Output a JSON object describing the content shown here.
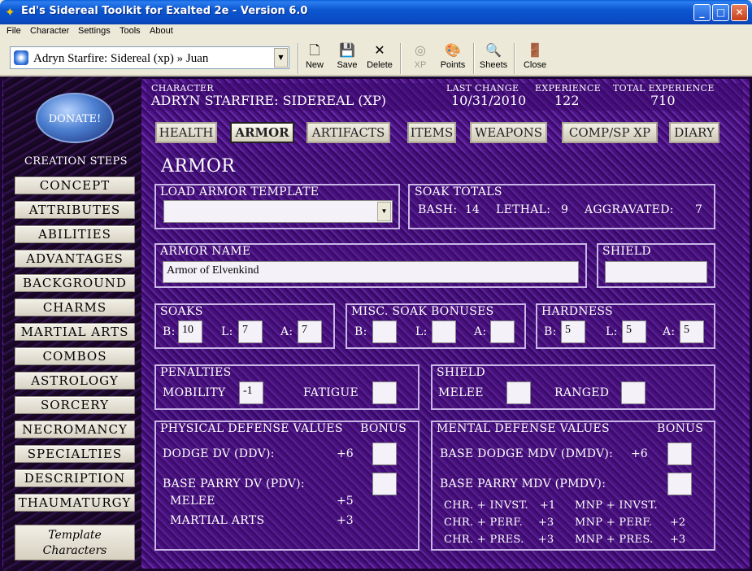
{
  "window": {
    "title": "Ed's Sidereal Toolkit for Exalted 2e - Version 6.0",
    "min_label": "_",
    "max_label": "□",
    "close_label": "✕"
  },
  "menu": [
    "File",
    "Character",
    "Settings",
    "Tools",
    "About"
  ],
  "toolbar": {
    "character_select": "Adryn Starfire: Sidereal (xp) » Juan",
    "buttons": [
      {
        "label": "New",
        "icon": "new-document-icon",
        "glyph": "🗋",
        "enabled": true
      },
      {
        "label": "Save",
        "icon": "save-disk-icon",
        "glyph": "💾",
        "enabled": true
      },
      {
        "label": "Delete",
        "icon": "delete-x-icon",
        "glyph": "✕",
        "enabled": true
      },
      {
        "label": "XP",
        "icon": "xp-icon",
        "glyph": "◎",
        "enabled": false
      },
      {
        "label": "Points",
        "icon": "points-palette-icon",
        "glyph": "🎨",
        "enabled": true
      },
      {
        "label": "Sheets",
        "icon": "sheets-search-icon",
        "glyph": "🔍",
        "enabled": true
      },
      {
        "label": "Close",
        "icon": "close-door-icon",
        "glyph": "🚪",
        "enabled": true
      }
    ]
  },
  "sidebar": {
    "donate_label": "DONATE!",
    "steps_title": "CREATION STEPS",
    "steps": [
      "Concept",
      "Attributes",
      "Abilities",
      "Advantages",
      "Background",
      "Charms",
      "Martial Arts",
      "Combos",
      "Astrology",
      "Sorcery",
      "Necromancy",
      "Specialties",
      "Description",
      "Thaumaturgy"
    ],
    "template_button": "Template Characters"
  },
  "header": {
    "character_label": "CHARACTER",
    "character_value": "ADRYN STARFIRE: SIDEREAL (XP)",
    "last_change_label": "LAST CHANGE",
    "last_change_value": "10/31/2010",
    "experience_label": "EXPERIENCE",
    "experience_value": "122",
    "total_experience_label": "TOTAL EXPERIENCE",
    "total_experience_value": "710"
  },
  "tabs": [
    "Health",
    "Armor",
    "Artifacts",
    "Items",
    "Weapons",
    "Comp/Sp XP",
    "Diary"
  ],
  "active_tab": "Armor",
  "armor": {
    "page_title": "ARMOR",
    "load_template_label": "LOAD ARMOR TEMPLATE",
    "load_template_value": "",
    "soak_totals_label": "SOAK TOTALS",
    "bash_label": "BASH:",
    "bash_value": "14",
    "lethal_label": "LETHAL:",
    "lethal_value": "9",
    "aggravated_label": "AGGRAVATED:",
    "aggravated_value": "7",
    "armor_name_label": "ARMOR NAME",
    "armor_name_value": "Armor of Elvenkind",
    "shield_label": "SHIELD",
    "shield_value": "",
    "soaks_label": "SOAKS",
    "soaks": {
      "b": "10",
      "l": "7",
      "a": "7"
    },
    "misc_label": "MISC. SOAK BONUSES",
    "misc": {
      "b": "",
      "l": "",
      "a": ""
    },
    "hardness_label": "HARDNESS",
    "hardness": {
      "b": "5",
      "l": "5",
      "a": "5"
    },
    "b_label": "B:",
    "l_label": "L:",
    "a_label": "A:",
    "penalties_label": "PENALTIES",
    "mobility_label": "MOBILITY",
    "mobility_value": "-1",
    "fatigue_label": "FATIGUE",
    "fatigue_value": "",
    "shield_pen_label": "SHIELD",
    "melee_label": "MELEE",
    "melee_value": "",
    "ranged_label": "RANGED",
    "ranged_value": ""
  },
  "physical_dv": {
    "title": "PHYSICAL DEFENSE VALUES",
    "bonus_label": "BONUS",
    "dodge_label": "DODGE DV (DDV):",
    "dodge_value": "+6",
    "parry_label": "BASE PARRY DV (PDV):",
    "melee_label": "MELEE",
    "melee_value": "+5",
    "martial_label": "MARTIAL ARTS",
    "martial_value": "+3"
  },
  "mental_dv": {
    "title": "MENTAL DEFENSE VALUES",
    "bonus_label": "BONUS",
    "dodge_label": "BASE DODGE MDV (DMDV):",
    "dodge_value": "+6",
    "parry_label": "BASE PARRY MDV (PMDV):",
    "rows": [
      {
        "l": "CHR. + INVST.",
        "lv": "+1",
        "r": "MNP + INVST.",
        "rv": ""
      },
      {
        "l": "CHR. + PERF.",
        "lv": "+3",
        "r": "MNP + PERF.",
        "rv": "+2"
      },
      {
        "l": "CHR. + PRES.",
        "lv": "+3",
        "r": "MNP + PRES.",
        "rv": "+3"
      }
    ]
  }
}
